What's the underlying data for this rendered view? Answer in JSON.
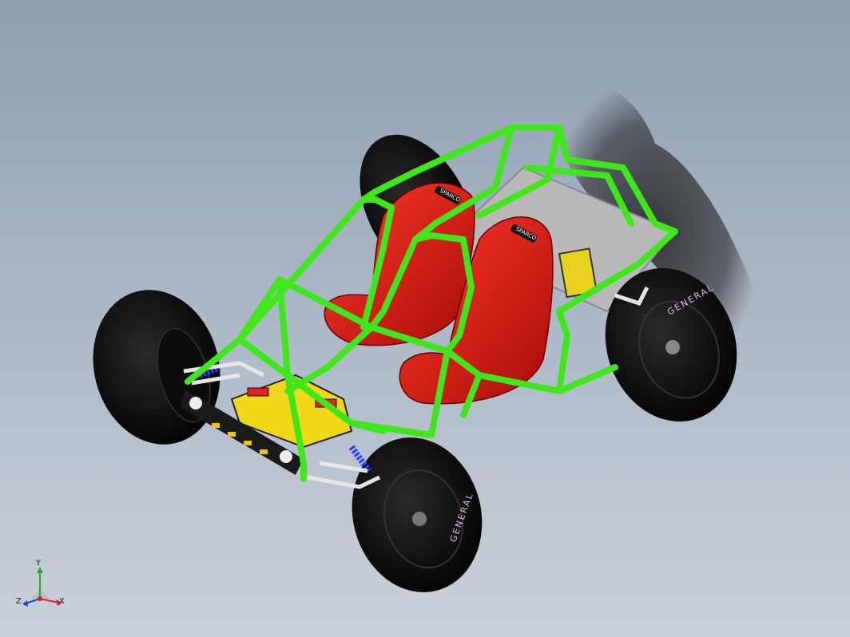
{
  "viewport": {
    "background_top": "#8e9db0",
    "background_bottom": "#c9d0d9"
  },
  "model": {
    "frame_color": "#3fe61c",
    "seat_color": "#e3110f",
    "tire_color": "#111111",
    "floor_color": "#b9b9b9",
    "spring_color": "#2e3cff",
    "battery_color": "#e6d21a",
    "seat_brand_text": "SPARCO",
    "tire_text": "GENERAL"
  },
  "triad": {
    "x_label": "X",
    "y_label": "Y",
    "z_label": "Z",
    "x_color": "#e02020",
    "y_color": "#20b020",
    "z_color": "#2040e0"
  }
}
